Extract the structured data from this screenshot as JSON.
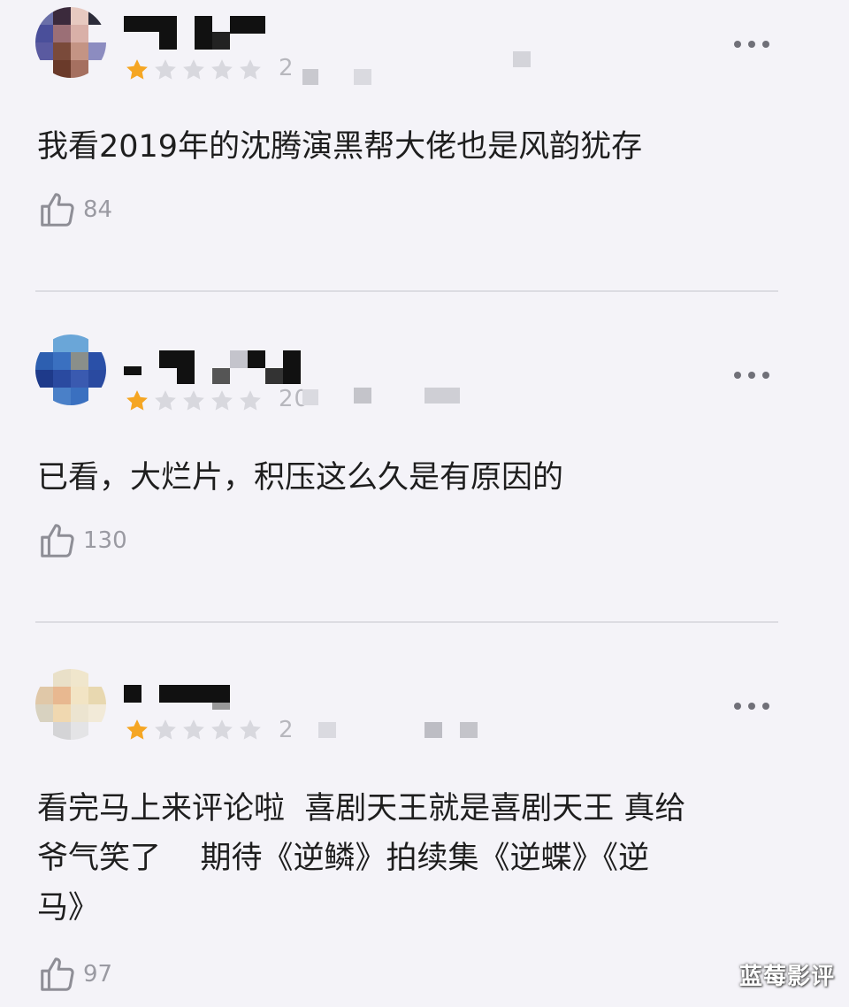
{
  "colors": {
    "background": "#f4f3f8",
    "star_active": "#f5a623",
    "star_inactive": "#d8d8de",
    "text": "#1e1e1e",
    "meta": "#9a9aa2"
  },
  "comments": [
    {
      "rating": 1,
      "max_rating": 5,
      "date_partial": "2",
      "text": "我看2019年的沈腾演黑帮大佬也是风韵犹存",
      "likes": "84"
    },
    {
      "rating": 1,
      "max_rating": 5,
      "date_partial": "20",
      "text": "已看，大烂片，积压这么久是有原因的",
      "likes": "130"
    },
    {
      "rating": 1,
      "max_rating": 5,
      "date_partial": "2",
      "text": "看完马上来评论啦  喜剧天王就是喜剧天王 真给\n爷气笑了    期待《逆鳞》拍续集《逆蝶》《逆\n马》",
      "likes": "97"
    }
  ],
  "icons": {
    "more": "more-dots-icon",
    "like": "thumbs-up-icon",
    "star": "star-icon"
  },
  "watermark": "蓝莓影评"
}
